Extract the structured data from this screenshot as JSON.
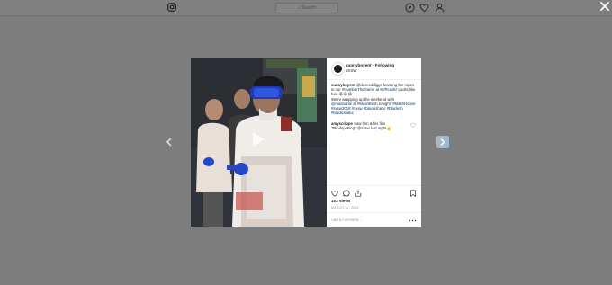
{
  "topbar": {
    "search_placeholder": "Search"
  },
  "post": {
    "username": "sunnyboyent",
    "follow_separator": " • ",
    "follow_label": "Following",
    "location": "SXSW",
    "caption_user": "sunnyboyent",
    "caption_text_1": "@daveeddiggs learning the ropes in our ",
    "caption_tag_1": "#HumbleTheGame",
    "caption_text_2": " at ",
    "caption_tag_2": "#VRcade",
    "caption_text_3": "! Looks like fun. 😂😂😂",
    "caption_text_4": "We're wrapping up the weekend with ",
    "caption_tag_3": "@mashable",
    "caption_text_5": " at ",
    "caption_tag_4": "#MashBash",
    "caption_text_6": " tonight! ",
    "caption_tags_tail": "#MashHouse #sxsw2018 #sxsw #blackishabc #blackish #blackishabc",
    "comment_user": "amyscrippe",
    "comment_text": "Saw him & his film \"Blindspotting\" @sxsw last night👍",
    "views": "103 views",
    "date": "MARCH 11, 2018",
    "add_comment_placeholder": "Add a comment…"
  },
  "icons": {
    "instagram": "instagram-icon",
    "explore": "compass-icon",
    "activity": "heart-icon",
    "profile": "user-icon",
    "close": "close-icon",
    "prev": "chevron-left-icon",
    "next": "chevron-right-icon",
    "play": "play-icon",
    "like": "heart-icon",
    "comment": "comment-icon",
    "share": "share-icon",
    "save": "bookmark-icon",
    "more": "more-icon"
  },
  "colors": {
    "overlay": "#7d7d7d",
    "link": "#003569",
    "next_button": "#a3b7c9"
  }
}
